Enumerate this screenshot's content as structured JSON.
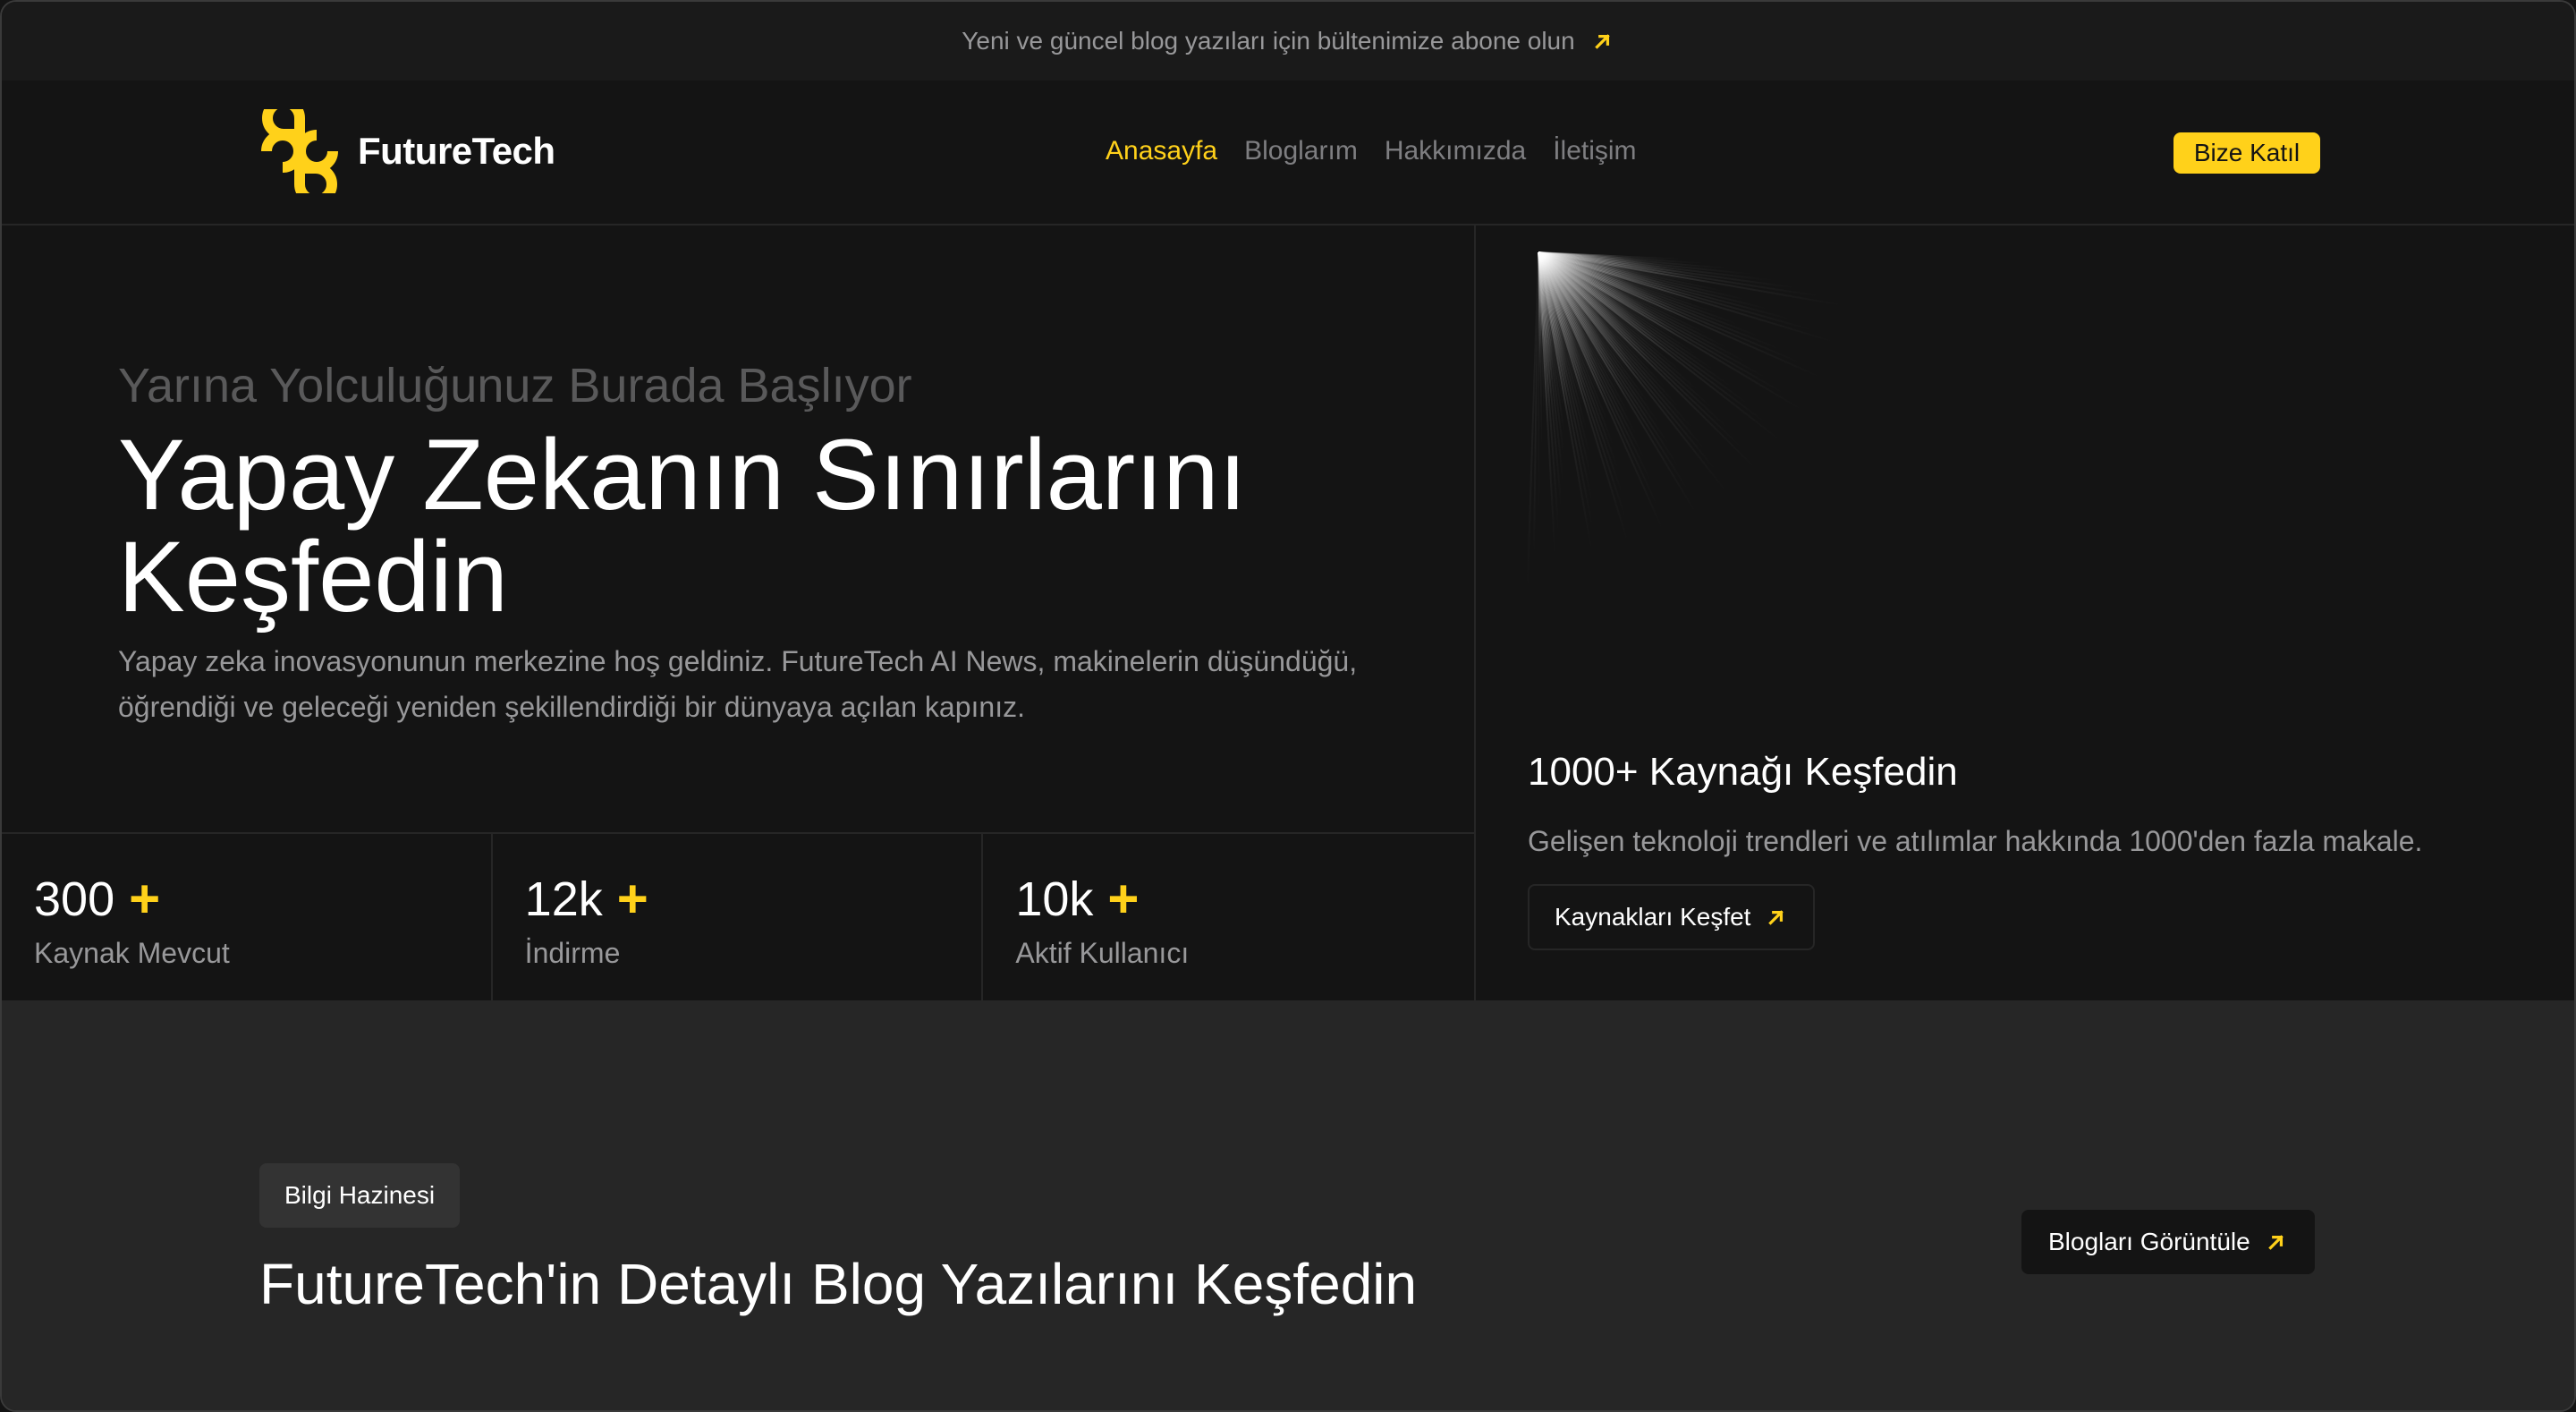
{
  "announcement": {
    "text": "Yeni ve güncel blog yazıları için bültenimize abone olun",
    "icon": "arrow-up-right-icon"
  },
  "navbar": {
    "logo_text": "FutureTech",
    "links": [
      {
        "label": "Anasayfa",
        "active": true
      },
      {
        "label": "Bloglarım",
        "active": false
      },
      {
        "label": "Hakkımızda",
        "active": false
      },
      {
        "label": "İletişim",
        "active": false
      }
    ],
    "cta_label": "Bize Katıl"
  },
  "hero": {
    "subtitle": "Yarına Yolculuğunuz Burada Başlıyor",
    "headline": "Yapay Zekanın Sınırlarını Keşfedin",
    "description": "Yapay zeka inovasyonunun merkezine hoş geldiniz. FutureTech AI News, makinelerin düşündüğü, öğrendiği ve geleceği yeniden şekillendirdiği bir dünyaya açılan kapınız.",
    "stats": [
      {
        "value": "300",
        "plus": "+",
        "label": "Kaynak Mevcut"
      },
      {
        "value": "12k",
        "plus": "+",
        "label": "İndirme"
      },
      {
        "value": "10k",
        "plus": "+",
        "label": "Aktif Kullanıcı"
      }
    ],
    "resources": {
      "title": "1000+ Kaynağı Keşfedin",
      "description": "Gelişen teknoloji trendleri ve atılımlar hakkında 1000'den fazla makale.",
      "button_label": "Kaynakları Keşfet"
    }
  },
  "section": {
    "tag": "Bilgi Hazinesi",
    "title": "FutureTech'in Detaylı Blog Yazılarını Keşfedin",
    "button_label": "Blogları Görüntüle"
  },
  "colors": {
    "accent": "#ffd11a",
    "background": "#141414",
    "surface": "#262626",
    "muted_text": "#98989a"
  }
}
